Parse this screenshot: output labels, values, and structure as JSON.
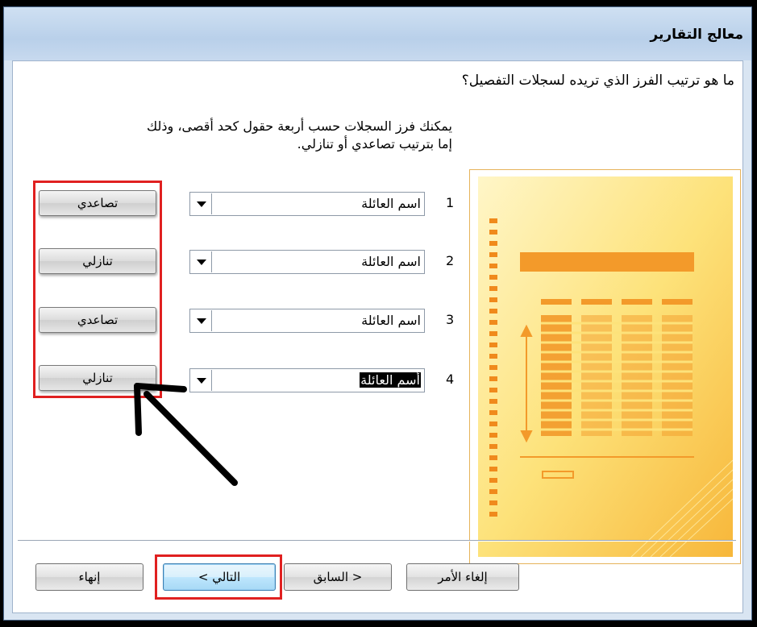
{
  "window": {
    "title": "معالج التقارير"
  },
  "main": {
    "question": "ما هو ترتيب الفرز الذي تريده لسجلات التفصيل؟",
    "description_line1": "يمكنك فرز السجلات حسب أربعة حقول كحد أقصى، وذلك",
    "description_line2": "إما بترتيب تصاعدي أو تنازلي."
  },
  "sort_rows": [
    {
      "number": "1",
      "field": "اسم العائلة",
      "order": "تصاعدي"
    },
    {
      "number": "2",
      "field": "اسم العائلة",
      "order": "تنازلي"
    },
    {
      "number": "3",
      "field": "اسم العائلة",
      "order": "تصاعدي"
    },
    {
      "number": "4",
      "field": "أسم العائلة",
      "order": "تنازلي"
    }
  ],
  "buttons": {
    "finish": "إنهاء",
    "next": "التالي >",
    "back": "< السابق",
    "cancel": "إلغاء الأمر"
  },
  "colors": {
    "highlight_border": "#e02020",
    "preview_orange": "#f39a2a",
    "preview_yellow": "#fbd44a"
  }
}
